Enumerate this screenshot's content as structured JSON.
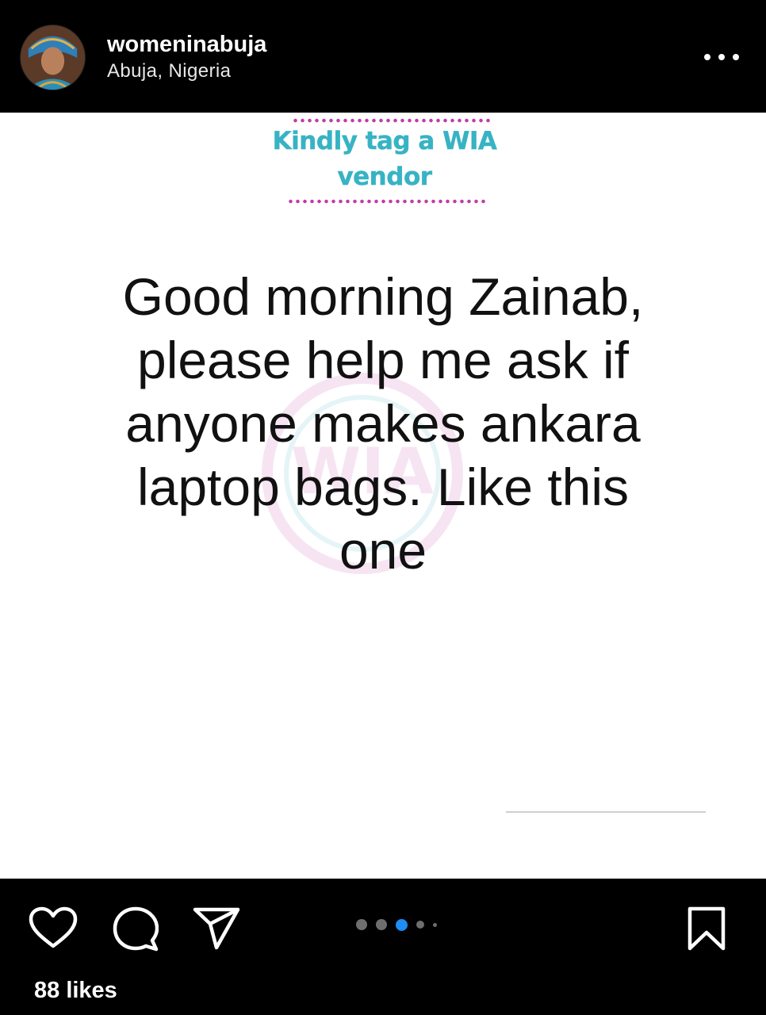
{
  "header": {
    "username": "womeninabuja",
    "location": "Abuja, Nigeria",
    "avatar_icon": "profile-avatar",
    "more_icon": "more-horizontal-icon"
  },
  "post": {
    "tag_line_1": "Kindly tag a WIA",
    "tag_line_2": "vendor",
    "message_lines": [
      "Good morning Zainab,",
      "please help me ask if",
      "anyone makes ankara",
      "laptop bags. Like this",
      "one"
    ],
    "watermark_text": "WIA",
    "colors": {
      "tag_text": "#37b3c4",
      "tag_dots": "#c23aa9",
      "message_text": "#111111",
      "background": "#ffffff"
    }
  },
  "actions": {
    "like_icon": "heart-icon",
    "comment_icon": "comment-bubble-icon",
    "share_icon": "paper-plane-icon",
    "save_icon": "bookmark-icon",
    "likes_label": "88 likes",
    "carousel": {
      "total_dots": 5,
      "active_index": 2,
      "active_color": "#1d8cf5",
      "inactive_color": "#6e6e6e"
    }
  }
}
